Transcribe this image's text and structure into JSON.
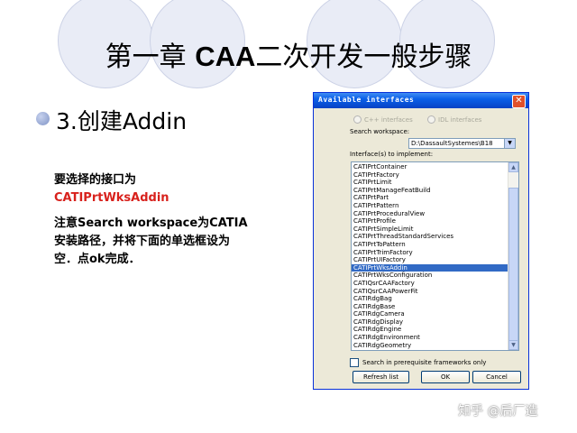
{
  "slide": {
    "title_part1": "第一章 ",
    "title_part2": "CAA",
    "title_part3": "二次开发一般步骤",
    "bullet": "3.创建Addin",
    "note_line1": "要选择的接口为",
    "note_interface": "CATIPrtWksAddin",
    "note_line3": "注意Search workspace为CATIA",
    "note_line4": "安装路径，并将下面的单选框设为",
    "note_line5": "空．点ok完成．",
    "accent_color": "#d8211c"
  },
  "dialog": {
    "title": "Available interfaces",
    "radio_cpp": "C++ interfaces",
    "radio_idl": "IDL interfaces",
    "search_workspace_label": "Search workspace:",
    "search_workspace_value": "D:\\DassaultSystemes\\B18",
    "interfaces_label": "Interface(s) to implement:",
    "interfaces": [
      "CATIPrtContainer",
      "CATIPrtFactory",
      "CATIPrtLimit",
      "CATIPrtManageFeatBuild",
      "CATIPrtPart",
      "CATIPrtPattern",
      "CATIPrtProceduralView",
      "CATIPrtProfile",
      "CATIPrtSimpleLimit",
      "CATIPrtThreadStandardServices",
      "CATIPrtToPattern",
      "CATIPrtTrimFactory",
      "CATIPrtUIFactory",
      "CATIPrtWksAddin",
      "CATIPrtWksConfiguration",
      "CATIQsrCAAFactory",
      "CATIQsrCAAPowerFit",
      "CATIRdgBag",
      "CATIRdgBase",
      "CATIRdgCamera",
      "CATIRdgDisplay",
      "CATIRdgEngine",
      "CATIRdgEnvironment",
      "CATIRdgGeometry"
    ],
    "selected_interface": "CATIPrtWksAddin",
    "checkbox_label": "Search in prerequisite frameworks only",
    "refresh_button": "Refresh list",
    "ok_button": "OK",
    "cancel_button": "Cancel"
  },
  "watermark": "知乎 @后厂造"
}
